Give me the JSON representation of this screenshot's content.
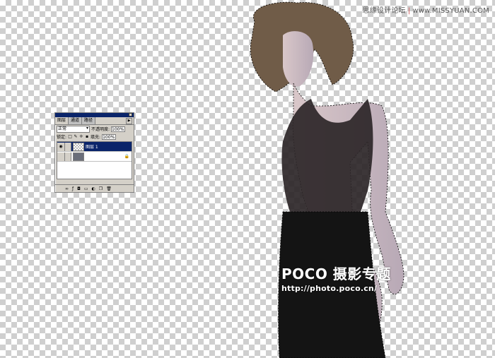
{
  "watermark": {
    "site_cn": "思缘设计论坛",
    "site_url": "www.MISSYUAN.COM",
    "separator": "|"
  },
  "layers_panel": {
    "tabs": [
      {
        "label": "图层",
        "active": true
      },
      {
        "label": "通道",
        "active": false
      },
      {
        "label": "路径",
        "active": false
      }
    ],
    "blend_mode": "正常",
    "opacity_label": "不透明度:",
    "opacity_value": "100%",
    "lock_label": "锁定:",
    "fill_label": "填充:",
    "fill_value": "100%",
    "layers": [
      {
        "name": "图层 1",
        "selected": true,
        "visible": true,
        "thumbnail": "transparent-checker"
      },
      {
        "name": "",
        "selected": false,
        "visible": false,
        "thumbnail": "background-photo",
        "locked": true
      }
    ],
    "bottom_icons": [
      "link-icon",
      "layer-style-icon",
      "mask-icon",
      "new-set-icon",
      "adjustment-icon",
      "new-layer-icon",
      "trash-icon"
    ]
  },
  "logo": {
    "brand": "POCO 摄影专题",
    "url": "http://photo.poco.cn/"
  },
  "colors": {
    "selection_blue": "#0a246a",
    "panel_gray": "#d4d0c8",
    "dress": "#141414",
    "hair": "#6e5a46"
  }
}
